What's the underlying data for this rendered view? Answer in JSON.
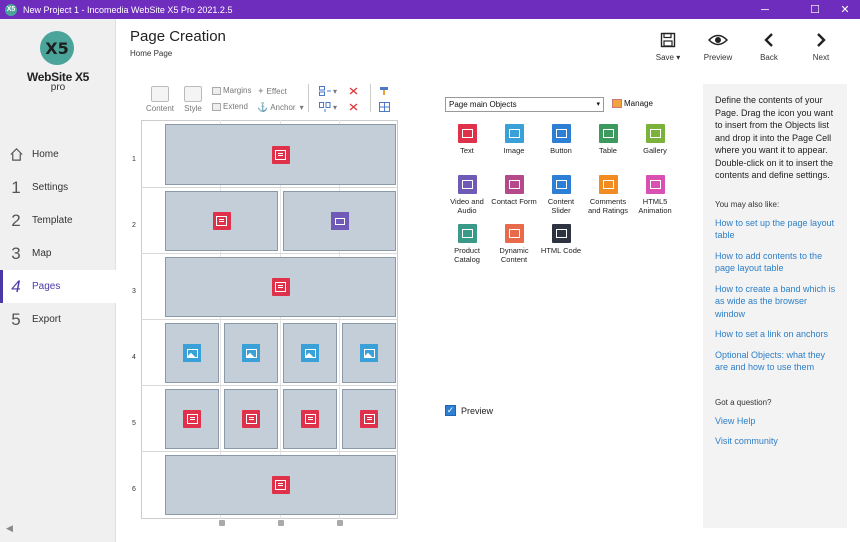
{
  "window": {
    "title": "New Project 1 - Incomedia WebSite X5 Pro 2021.2.5",
    "minimize": "─",
    "maximize": "☐",
    "close": "✕"
  },
  "sidebar": {
    "logo_mark": "X5",
    "logo_text": "WebSite X5",
    "logo_sub": "pro",
    "items": [
      {
        "num": "",
        "label": "Home"
      },
      {
        "num": "1",
        "label": "Settings"
      },
      {
        "num": "2",
        "label": "Template"
      },
      {
        "num": "3",
        "label": "Map"
      },
      {
        "num": "4",
        "label": "Pages"
      },
      {
        "num": "5",
        "label": "Export"
      }
    ],
    "collapse": "◀"
  },
  "header": {
    "title": "Page Creation",
    "breadcrumb": "Home Page",
    "save": "Save",
    "save_arrow": "▾",
    "preview": "Preview",
    "back": "Back",
    "next": "Next"
  },
  "toolbar": {
    "content": "Content",
    "style": "Style",
    "margins": "Margins",
    "extend": "Extend",
    "effect": "Effect",
    "anchor": "Anchor",
    "dropdown": "▾"
  },
  "grid": {
    "rows": [
      "1",
      "2",
      "3",
      "4",
      "5",
      "6"
    ]
  },
  "objects": {
    "select_value": "Page main Objects",
    "select_arrow": "▾",
    "manage": "Manage",
    "items": [
      {
        "label": "Text",
        "color": "#e0314b"
      },
      {
        "label": "Image",
        "color": "#3aa0d8"
      },
      {
        "label": "Button",
        "color": "#2c7fd4"
      },
      {
        "label": "Table",
        "color": "#3c9a5f"
      },
      {
        "label": "Gallery",
        "color": "#7bb33a"
      },
      {
        "label": "Video and Audio",
        "color": "#6f5ab5"
      },
      {
        "label": "Contact Form",
        "color": "#b54a8a"
      },
      {
        "label": "Content Slider",
        "color": "#2c7fd4"
      },
      {
        "label": "Comments and Ratings",
        "color": "#f08c22"
      },
      {
        "label": "HTML5 Animation",
        "color": "#d94fb4"
      },
      {
        "label": "Product Catalog",
        "color": "#3a9a8a"
      },
      {
        "label": "Dynamic Content",
        "color": "#e86a4a"
      },
      {
        "label": "HTML Code",
        "color": "#2d3340"
      }
    ],
    "preview_label": "Preview",
    "preview_check": "✓"
  },
  "help": {
    "intro": "Define the contents of your Page. Drag the icon you want to insert from the Objects list and drop it into the Page Cell where you want it to appear. Double-click on it to insert the contents and define settings.",
    "also_like": "You may also like:",
    "links": [
      "How to set up the page layout table",
      "How to add contents to the page layout table",
      "How to create a band which is as wide as the browser window",
      "How to set a link on anchors",
      "Optional Objects: what they are and how to use them"
    ],
    "question": "Got a question?",
    "view_help": "View Help",
    "visit_community": "Visit community"
  }
}
